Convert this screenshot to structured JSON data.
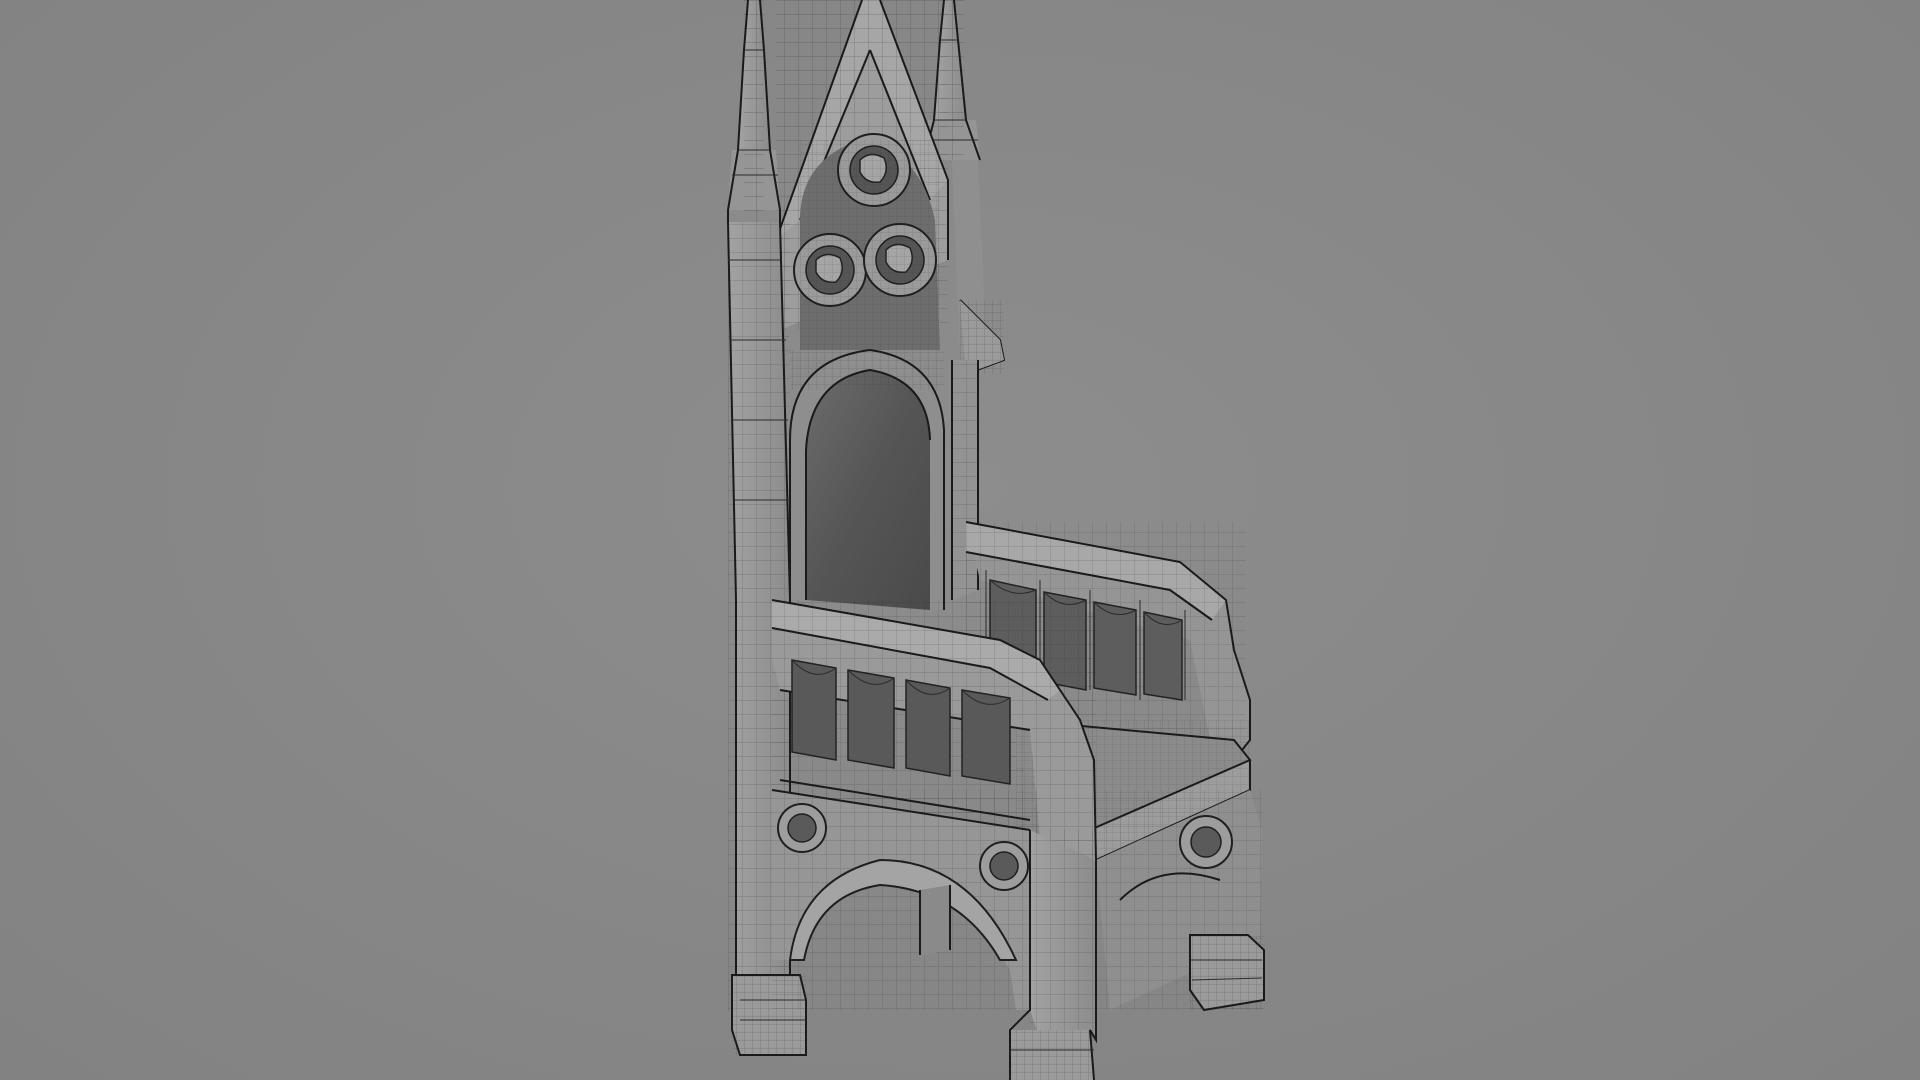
{
  "viewport": {
    "background_color": "#858585",
    "subject": "gothic-throne-chair-wireframe",
    "wire_color": "#2b2b2b"
  }
}
